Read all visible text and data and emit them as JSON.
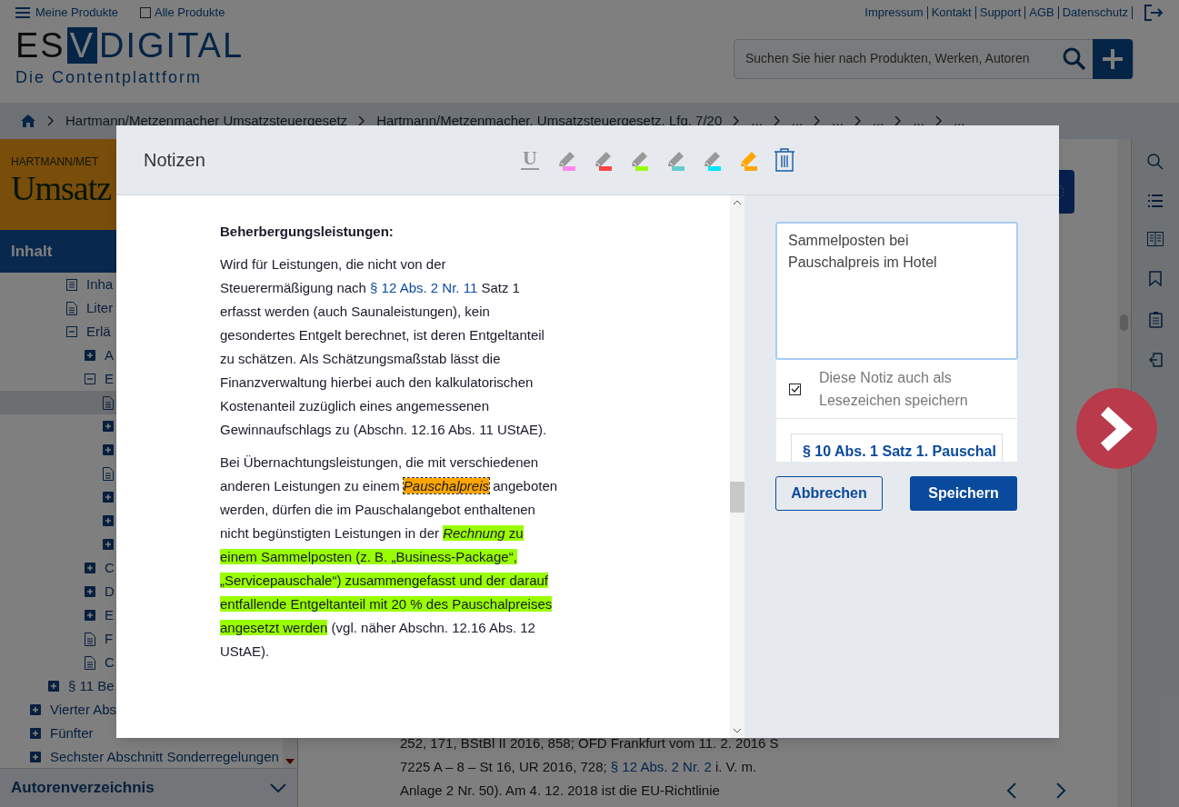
{
  "topbar": {
    "menu_label": "Meine Produkte",
    "all_products": {
      "label": "Alle Produkte",
      "checked": false
    },
    "links": [
      "Impressum",
      "Kontakt",
      "Support",
      "AGB",
      "Datenschutz"
    ]
  },
  "logo": {
    "left": "ES",
    "box": "V",
    "right": "DIGITAL",
    "tagline": "Die Contentplattform"
  },
  "search": {
    "placeholder": "Suchen Sie hier nach Produkten, Werken, Autoren"
  },
  "breadcrumb": [
    "Hartmann/Metzenmacher Umsatzsteuergesetz",
    "Hartmann/Metzenmacher, Umsatzsteuergesetz, Lfg. 7/20",
    "...",
    "...",
    "...",
    "...",
    "...",
    "..."
  ],
  "book_cover": {
    "author": "HARTMANN/MET",
    "title": "Umsatz"
  },
  "sidebar": {
    "title": "Inhalt",
    "footer": "Autorenverzeichnis",
    "tree": [
      {
        "children": [
          {
            "children": [
              {
                "label": "Inha",
                "kind": "list",
                "selected": false
              },
              {
                "label": "Liter",
                "kind": "doc",
                "selected": false
              },
              {
                "label": "Erlä",
                "kind": "folder",
                "expanded": true,
                "selected": false,
                "children": [
                  {
                    "label": "A",
                    "kind": "folder",
                    "expanded": false,
                    "selected": false
                  },
                  {
                    "label": "E",
                    "kind": "folder",
                    "expanded": true,
                    "selected": false,
                    "children": [
                      {
                        "kind": "doc",
                        "selected": true
                      },
                      {
                        "kind": "folder",
                        "expanded": false,
                        "selected": false
                      },
                      {
                        "kind": "folder",
                        "expanded": false,
                        "selected": false
                      },
                      {
                        "kind": "doc",
                        "selected": false
                      },
                      {
                        "kind": "folder",
                        "expanded": false,
                        "selected": false
                      },
                      {
                        "kind": "folder",
                        "expanded": false,
                        "selected": false
                      },
                      {
                        "kind": "folder",
                        "expanded": false,
                        "selected": false
                      }
                    ]
                  },
                  {
                    "label": "C",
                    "kind": "folder",
                    "expanded": false,
                    "selected": false
                  },
                  {
                    "label": "D",
                    "kind": "folder",
                    "expanded": false,
                    "selected": false
                  },
                  {
                    "label": "E",
                    "kind": "folder",
                    "expanded": false,
                    "selected": false
                  },
                  {
                    "label": "F",
                    "kind": "doc",
                    "selected": false
                  },
                  {
                    "label": "C",
                    "kind": "doc",
                    "selected": false
                  }
                ]
              }
            ]
          },
          {
            "label": "§ 11 Be",
            "kind": "folder",
            "expanded": false,
            "selected": false
          }
        ]
      },
      {
        "label": "Vierter Abs",
        "kind": "folder",
        "expanded": false,
        "selected": false
      },
      {
        "label": "Fünfter",
        "kind": "folder",
        "expanded": false,
        "selected": false
      },
      {
        "label": "Sechster Abschnitt Sonderregelungen",
        "kind": "folder",
        "expanded": false,
        "selected": false
      }
    ]
  },
  "content": {
    "lines": [
      [
        {
          "text": "252, 171, BStBl II 2016, 858; OFD Frankfurt vom 11. 2. 2016 S",
          "kind": "text"
        }
      ],
      [
        {
          "text": "7225 A – 8 – St 16, UR 2016, 728; ",
          "kind": "text"
        },
        {
          "text": "§ 12 Abs. 2 Nr. 2",
          "kind": "link"
        },
        {
          "text": " i. V. m.",
          "kind": "text"
        }
      ],
      [
        {
          "text": "Anlage 2 Nr. 50). Am 4. 12. 2018 ist die EU-Richtlinie",
          "kind": "text"
        }
      ]
    ]
  },
  "modal": {
    "title": "Notizen",
    "tools": [
      {
        "kind": "underline",
        "label": "U",
        "selected": false
      },
      {
        "kind": "marker",
        "color": "#ff88ee",
        "selected": false
      },
      {
        "kind": "marker",
        "color": "#ff4444",
        "selected": false
      },
      {
        "kind": "marker",
        "color": "#99ff00",
        "selected": false
      },
      {
        "kind": "marker",
        "color": "#66cccc",
        "selected": false
      },
      {
        "kind": "marker",
        "color": "#00e5ff",
        "selected": false
      },
      {
        "kind": "marker",
        "color": "#ffa500",
        "selected": true
      },
      {
        "kind": "delete"
      }
    ],
    "paragraphs": [
      {
        "kind": "heading",
        "segments": [
          {
            "text": "Beherbergungsleistungen:",
            "kind": "text"
          }
        ]
      },
      {
        "kind": "body",
        "segments": [
          {
            "text": "Wird für Leistungen, die nicht von der Steuerermäßigung nach ",
            "kind": "text"
          },
          {
            "text": "§ 12 Abs. 2 Nr. 11",
            "kind": "link"
          },
          {
            "text": " Satz 1 erfasst werden (auch Saunaleistungen), kein gesondertes Entgelt berechnet, ist deren Entgeltanteil zu schätzen. Als Schätzungsmaßstab lässt die Finanzverwaltung hierbei auch den kalkulatorischen Kostenanteil zuzüglich eines angemessenen Gewinnaufschlags zu (Abschn. 12.16 Abs. 11  UStAE).",
            "kind": "text"
          }
        ]
      },
      {
        "kind": "body",
        "segments": [
          {
            "text": "Bei Übernachtungsleistungen, die mit verschiedenen anderen Leistungen zu einem ",
            "kind": "text"
          },
          {
            "text": "Pauschalpreis",
            "kind": "mark",
            "color": "#ffa500",
            "italic": true,
            "focused": true
          },
          {
            "text": " angeboten werden, dürfen die im Pauschalangebot enthaltenen nicht begünstigten Leistungen in der ",
            "kind": "text"
          },
          {
            "text": "Rechnung",
            "kind": "mark",
            "color": "#99ff00",
            "italic": true,
            "focused": false
          },
          {
            "text": " zu einem Sammelposten (z. B. „Business-Package“, „Servicepauschale“) zusammengefasst und der darauf entfallende Entgeltanteil mit 20 % des Pauschalpreises angesetzt werden",
            "kind": "mark",
            "color": "#99ff00",
            "italic": false,
            "focused": false
          },
          {
            "text": " (vgl. näher Abschn. 12.16 Abs. 12 UStAE).",
            "kind": "text"
          }
        ]
      }
    ],
    "note": "Sammelposten bei\nPauschalpreis im Hotel",
    "bookmark": {
      "label": "Diese Notiz auch als Lesezeichen speichern",
      "checked": true
    },
    "bookmark_title": "§ 10 Abs. 1 Satz 1. Pauschal",
    "buttons": [
      {
        "label": "Abbrechen",
        "kind": "secondary"
      },
      {
        "label": "Speichern",
        "kind": "primary"
      }
    ]
  }
}
